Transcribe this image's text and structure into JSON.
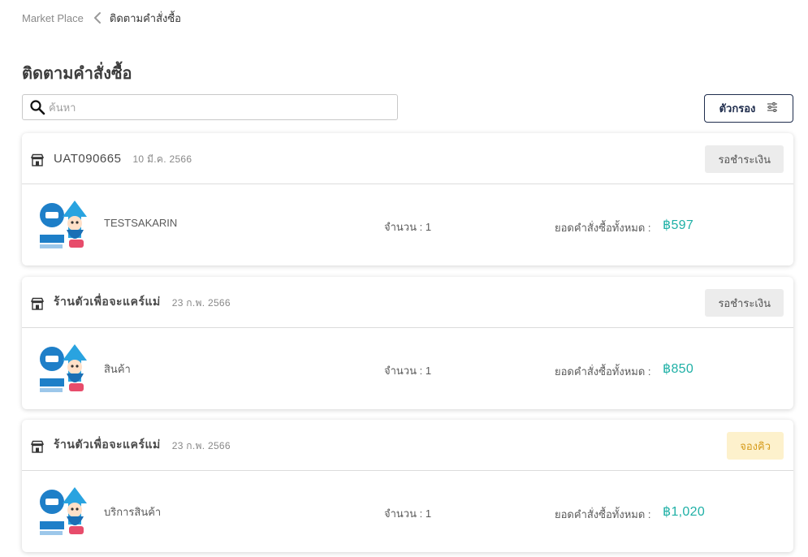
{
  "breadcrumb": {
    "root": "Market Place",
    "current": "ติดตามคำสั่งซื้อ"
  },
  "page": {
    "title": "ติดตามคำสั่งซื้อ"
  },
  "search": {
    "placeholder": "ค้นหา",
    "value": ""
  },
  "filter": {
    "label": "ตัวกรอง"
  },
  "colors": {
    "accent_price": "#1fb0a6",
    "booked_badge_bg": "#fdf1cc",
    "booked_badge_text": "#d59b1b",
    "filter_border": "#1f2d4d"
  },
  "orders": [
    {
      "id": "UAT090665",
      "date": "10 มี.ค. 2566",
      "status": "รอชำระเงิน",
      "product": "TESTSAKARIN",
      "qty_label": "จำนวน : 1",
      "total_label": "ยอดคำสั่งซื้อทั้งหมด :",
      "total": "฿597"
    },
    {
      "id": "ร้านตัวเพื่อจะแคร์แม่",
      "date": "23 ก.พ. 2566",
      "status": "รอชำระเงิน",
      "product": "สินค้า",
      "qty_label": "จำนวน : 1",
      "total_label": "ยอดคำสั่งซื้อทั้งหมด :",
      "total": "฿850"
    },
    {
      "id": "ร้านตัวเพื่อจะแคร์แม่",
      "date": "23 ก.พ. 2566",
      "status": "จองคิว",
      "product": "บริการสินค้า",
      "qty_label": "จำนวน : 1",
      "total_label": "ยอดคำสั่งซื้อทั้งหมด :",
      "total": "฿1,020"
    }
  ],
  "icons": {
    "search": "search-icon",
    "filter": "sliders-icon",
    "shop": "store-icon",
    "breadcrumb_sep": "chevron-left-icon"
  }
}
